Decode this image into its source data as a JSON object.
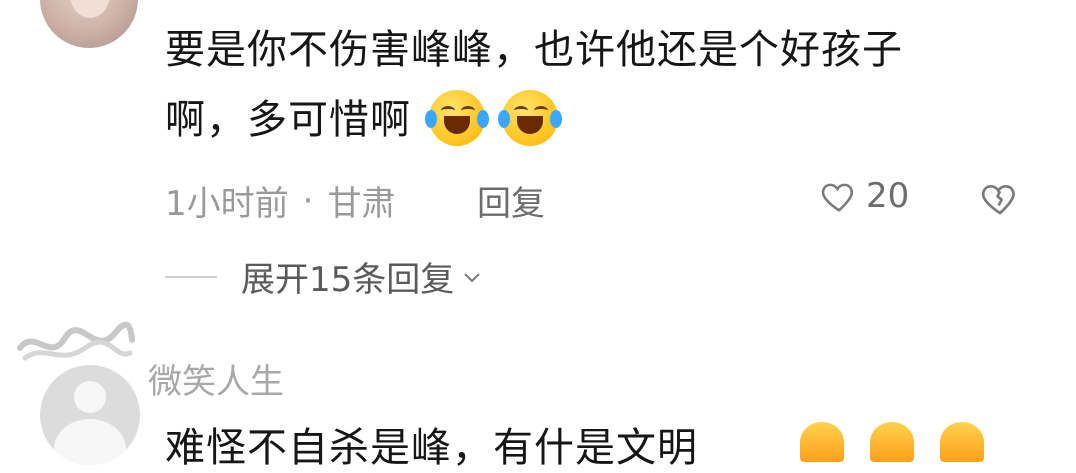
{
  "comments": [
    {
      "text_line1": "要是你不伤害峰峰，也许他还是个好孩子",
      "text_line2": "啊，多可惜啊",
      "emoji": [
        "laughing-crying-emoji",
        "laughing-crying-emoji"
      ],
      "time": "1小时前",
      "separator": "·",
      "location": "甘肃",
      "reply_label": "回复",
      "like_count": "20",
      "expand_label": "展开15条回复"
    },
    {
      "username": "微笑人生",
      "text": "难怪不自杀是峰，有什是文明"
    }
  ],
  "icons": {
    "heart": "heart-outline-icon",
    "dislike": "broken-heart-icon",
    "chevron": "chevron-down-icon"
  },
  "colors": {
    "text": "#161616",
    "meta": "#9a9a9a",
    "action": "#6c6c6c"
  }
}
